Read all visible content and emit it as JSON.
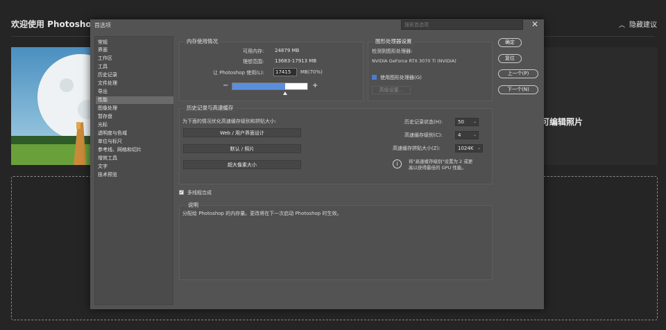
{
  "home": {
    "title": "欢迎使用 Photoshop,",
    "hide_tips": "隐藏建议",
    "card_text": "可编辑照片"
  },
  "dialog": {
    "title": "首选项",
    "search_placeholder": "搜索首选项",
    "sidebar": [
      "常规",
      "界面",
      "工作区",
      "工具",
      "历史记录",
      "文件处理",
      "导出",
      "性能",
      "图像处理",
      "暂存盘",
      "光标",
      "透明度与色域",
      "单位与标尺",
      "参考线、网格和切片",
      "增效工具",
      "文字",
      "技术预览"
    ],
    "active_item": "性能",
    "memory": {
      "heading": "内存使用情况",
      "available_label": "可用内存:",
      "available_value": "24879 MB",
      "ideal_label": "理想范围:",
      "ideal_value": "13683-17913 MB",
      "use_label": "让 Photoshop 使用(L):",
      "use_value": "17415",
      "use_suffix": "MB(70%)",
      "fraction": 0.7,
      "minus": "−",
      "plus": "+"
    },
    "gpu": {
      "heading": "图形处理器设置",
      "detected_label": "检测到图形处理器:",
      "gpu_name": "NVIDIA GeForce RTX 3070 Ti (NVIDIA)",
      "use_gpu_label": "使用图形处理器(G)",
      "advanced_label": "高级设置..."
    },
    "history": {
      "heading": "历史记录与高速缓存",
      "optimize_label": "为下面的情况优化高速缓存级别和拼贴大小:",
      "btn_web": "Web / 用户界面设计",
      "btn_default": "默认 / 照片",
      "btn_huge": "超大像素大小",
      "states_label": "历史记录状态(H):",
      "states_value": "50",
      "levels_label": "高速缓存级别(C):",
      "levels_value": "4",
      "tile_label": "高速缓存拼贴大小(Z):",
      "tile_value": "1024K",
      "info_line1": "将\"高速缓存级别\"设置为 2 或更",
      "info_line2": "高以获得最佳的 GPU 性能。",
      "info_icon": "i"
    },
    "multithread_label": "多线程合成",
    "description": {
      "heading": "说明",
      "text": "分配给 Photoshop 的内存量。更改将在下一次启动 Photoshop 时生效。"
    },
    "buttons": {
      "ok": "确定",
      "reset": "复位",
      "prev": "上一个(P)",
      "next": "下一个(N)"
    },
    "close_glyph": "✕"
  }
}
